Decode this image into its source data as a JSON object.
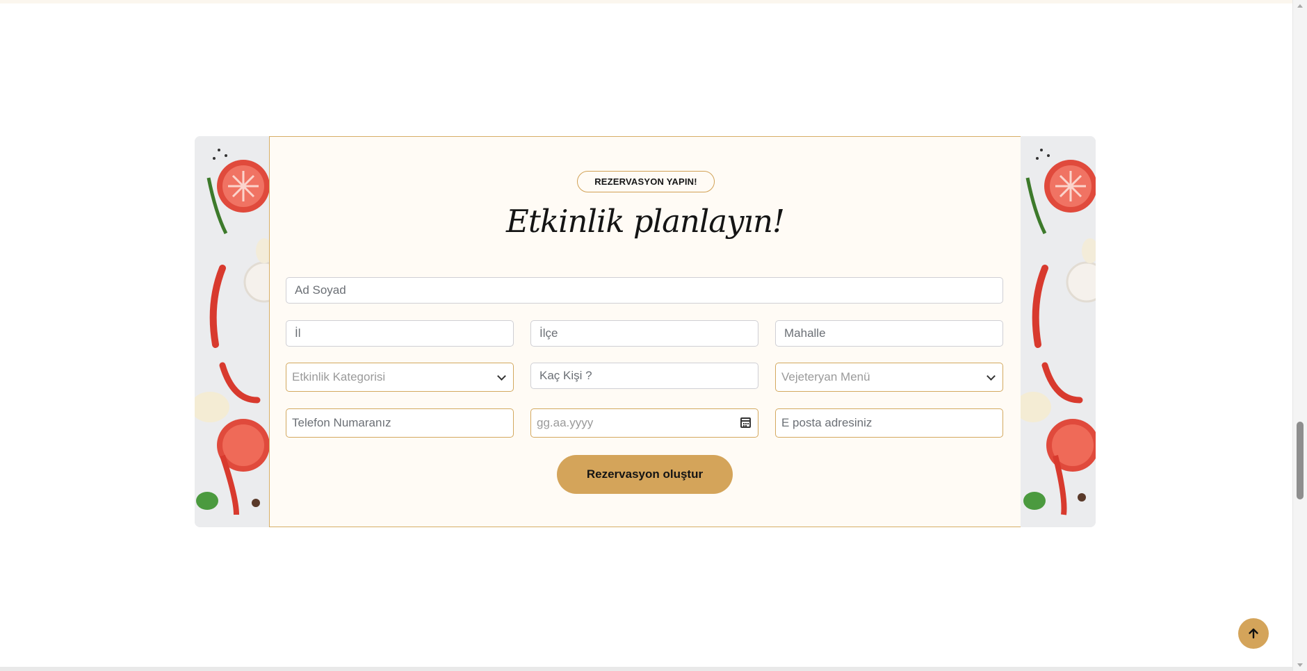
{
  "badge": "REZERVASYON YAPIN!",
  "title": "Etkinlik planlayın!",
  "form": {
    "full_name_placeholder": "Ad Soyad",
    "city_placeholder": "İl",
    "district_placeholder": "İlçe",
    "neighborhood_placeholder": "Mahalle",
    "event_category_selected": "Etkinlik Kategorisi",
    "guest_count_placeholder": "Kaç Kişi ?",
    "vegetarian_menu_selected": "Vejeteryan Menü",
    "phone_placeholder": "Telefon Numaranız",
    "date_placeholder": "gg.aa.yyyy",
    "email_placeholder": "E posta adresiniz",
    "submit_label": "Rezervasyon oluştur"
  },
  "icons": {
    "dropdown": "chevron-down-icon",
    "date": "calendar-icon",
    "back_to_top": "arrow-up-icon"
  },
  "colors": {
    "accent": "#d4a45a",
    "panel_background": "#fffbf5",
    "panel_border": "#d6ae66"
  }
}
